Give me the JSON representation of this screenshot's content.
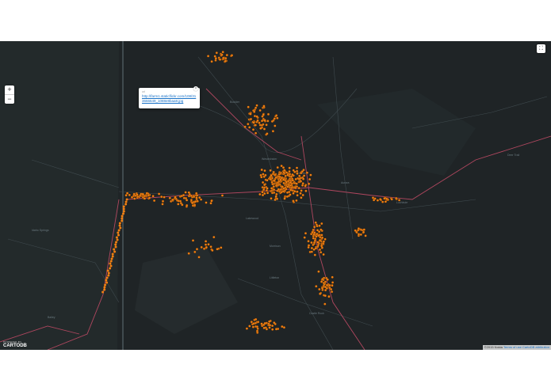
{
  "zoom": {
    "in_label": "+",
    "out_label": "−"
  },
  "fullscreen": {
    "label": "⛶"
  },
  "popup": {
    "field_label": "url",
    "value": "http://farm1.staticflickr.com/108/313666649_1088e8baa8.jpg",
    "close_label": "×"
  },
  "logo": {
    "powered_label": "POWERED BY",
    "brand": "CARTODB"
  },
  "attribution": {
    "text": "©2015 Nokia",
    "terms": "Terms of use",
    "carto": "CartoDB attribution"
  },
  "colors": {
    "map_background": "#1f2426",
    "point": "#f07f12",
    "highway": "#b0475f",
    "road": "#3a4448"
  }
}
